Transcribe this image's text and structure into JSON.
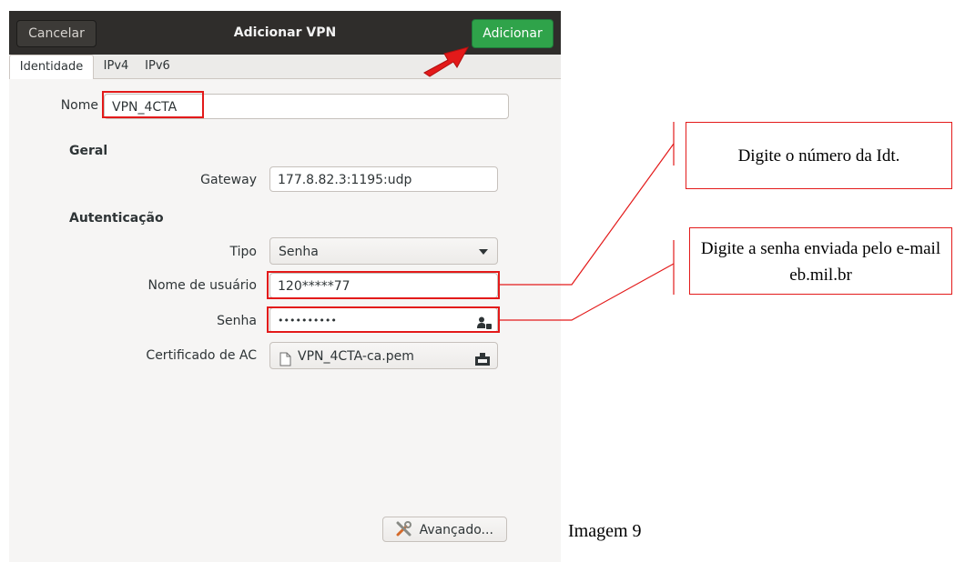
{
  "window": {
    "title": "Adicionar VPN",
    "cancel_label": "Cancelar",
    "add_label": "Adicionar"
  },
  "tabs": [
    {
      "label": "Identidade",
      "active": true
    },
    {
      "label": "IPv4",
      "active": false
    },
    {
      "label": "IPv6",
      "active": false
    }
  ],
  "form": {
    "name_label": "Nome",
    "name_value": "VPN_4CTA",
    "general_section": "Geral",
    "gateway_label": "Gateway",
    "gateway_value": "177.8.82.3:1195:udp",
    "auth_section": "Autenticação",
    "type_label": "Tipo",
    "type_value": "Senha",
    "username_label": "Nome de usuário",
    "username_value": "120*****77",
    "password_label": "Senha",
    "password_value": "••••••••••",
    "ca_label": "Certificado de AC",
    "ca_value": "VPN_4CTA-ca.pem",
    "advanced_label": "Avançado..."
  },
  "annotations": {
    "callout_idt": "Digite o número da Idt.",
    "callout_senha": "Digite a senha enviada pelo e-mail eb.mil.br",
    "caption": "Imagem 9"
  },
  "colors": {
    "titlebar": "#2f2d2b",
    "add_button": "#2fa34a",
    "highlight": "#e31a1a"
  }
}
